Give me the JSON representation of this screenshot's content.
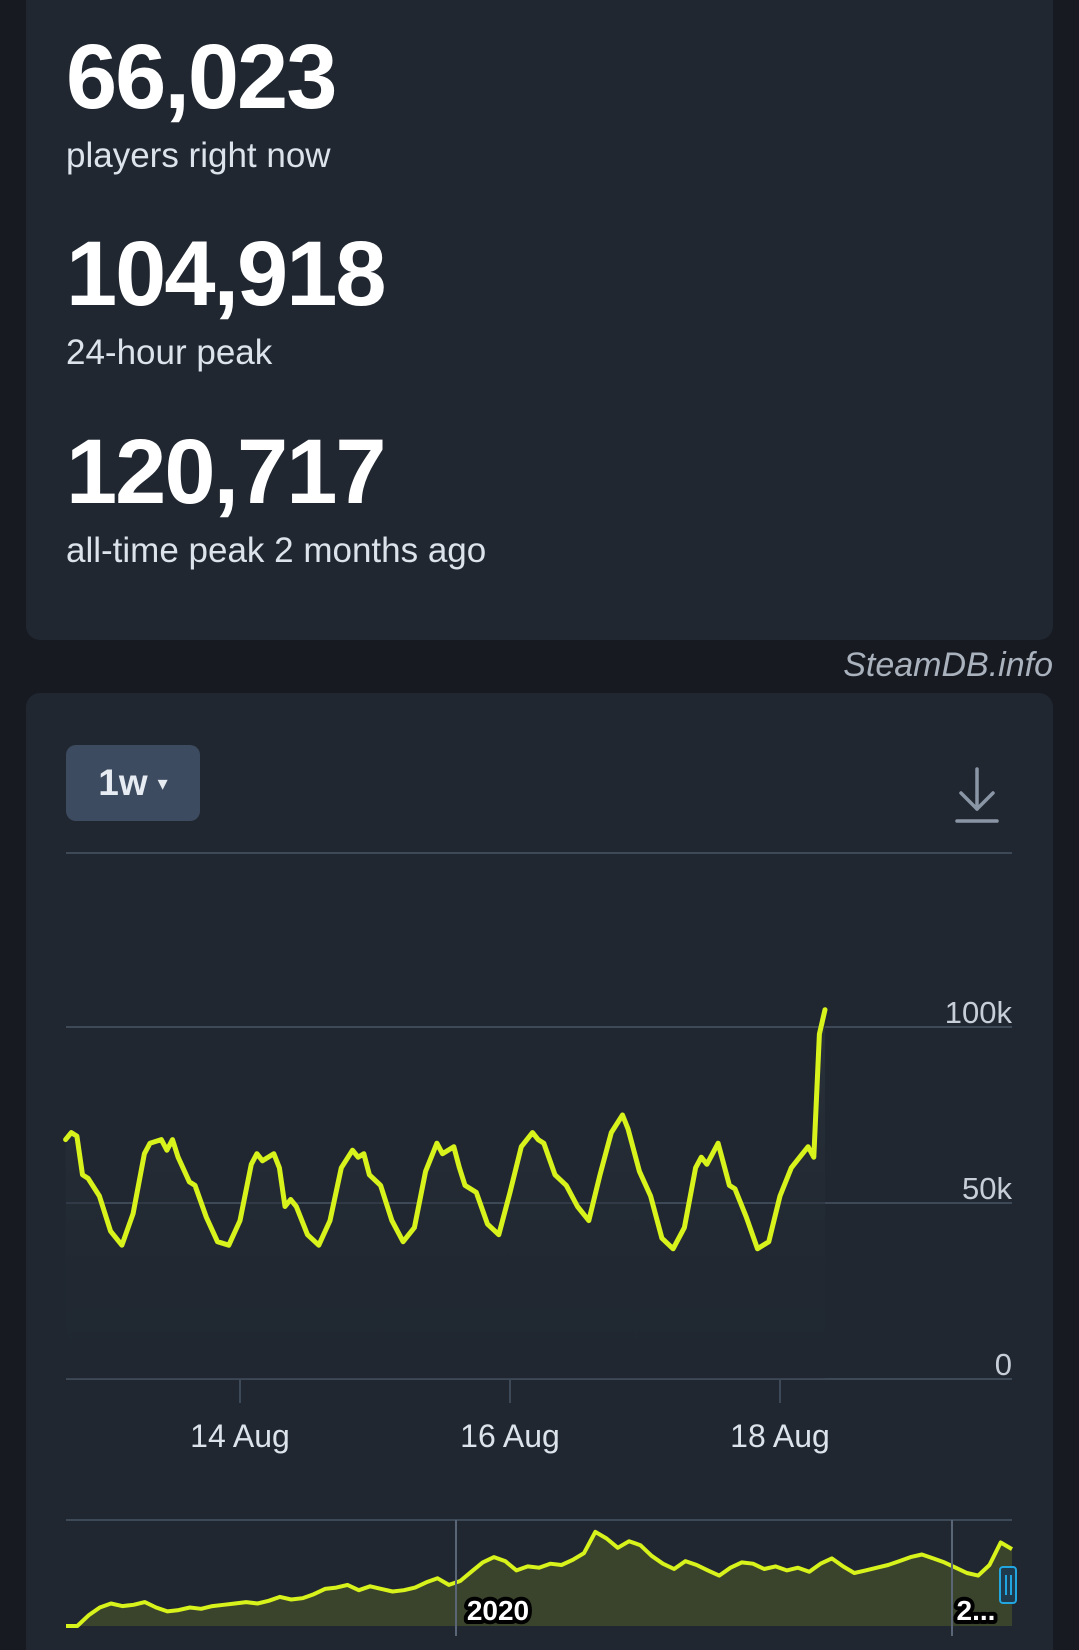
{
  "stats": {
    "current_players": {
      "value": "66,023",
      "label": "players right now"
    },
    "peak_24h": {
      "value": "104,918",
      "label": "24-hour peak"
    },
    "all_time_peak": {
      "value": "120,717",
      "label": "all-time peak 2 months ago"
    }
  },
  "watermark": "SteamDB.info",
  "controls": {
    "range_label": "1w",
    "range_caret": "▾",
    "download_icon": "download-icon"
  },
  "colors": {
    "line": "#d8f31c",
    "background": "#202731",
    "grid": "#3e4958"
  },
  "chart_data": [
    {
      "type": "line",
      "title": "",
      "xlabel": "",
      "ylabel": "",
      "ylim": [
        0,
        100000
      ],
      "yticks": [
        0,
        50000,
        100000
      ],
      "ytick_labels": [
        "0",
        "50k",
        "100k"
      ],
      "xticks": [
        "2020-08-14",
        "2020-08-16",
        "2020-08-18"
      ],
      "xtick_labels": [
        "14 Aug",
        "16 Aug",
        "18 Aug"
      ],
      "grid": true,
      "series": [
        {
          "name": "",
          "color": "#d8f31c",
          "points": [
            [
              "2020-08-12T17:00",
              68000
            ],
            [
              "2020-08-12T18:00",
              70000
            ],
            [
              "2020-08-12T19:00",
              69000
            ],
            [
              "2020-08-12T20:00",
              58000
            ],
            [
              "2020-08-12T21:00",
              57000
            ],
            [
              "2020-08-12T23:00",
              52000
            ],
            [
              "2020-08-13T01:00",
              42000
            ],
            [
              "2020-08-13T03:00",
              38000
            ],
            [
              "2020-08-13T05:00",
              47000
            ],
            [
              "2020-08-13T07:00",
              64000
            ],
            [
              "2020-08-13T08:00",
              67000
            ],
            [
              "2020-08-13T10:00",
              68000
            ],
            [
              "2020-08-13T11:00",
              65000
            ],
            [
              "2020-08-13T12:00",
              68000
            ],
            [
              "2020-08-13T13:00",
              63000
            ],
            [
              "2020-08-13T15:00",
              56000
            ],
            [
              "2020-08-13T16:00",
              55000
            ],
            [
              "2020-08-13T18:00",
              46000
            ],
            [
              "2020-08-13T20:00",
              39000
            ],
            [
              "2020-08-13T22:00",
              38000
            ],
            [
              "2020-08-14T00:00",
              45000
            ],
            [
              "2020-08-14T02:00",
              61000
            ],
            [
              "2020-08-14T03:00",
              64000
            ],
            [
              "2020-08-14T04:00",
              62000
            ],
            [
              "2020-08-14T06:00",
              64000
            ],
            [
              "2020-08-14T07:00",
              60000
            ],
            [
              "2020-08-14T08:00",
              49000
            ],
            [
              "2020-08-14T09:00",
              51000
            ],
            [
              "2020-08-14T10:00",
              49000
            ],
            [
              "2020-08-14T12:00",
              41000
            ],
            [
              "2020-08-14T14:00",
              38000
            ],
            [
              "2020-08-14T16:00",
              45000
            ],
            [
              "2020-08-14T18:00",
              60000
            ],
            [
              "2020-08-14T20:00",
              65000
            ],
            [
              "2020-08-14T21:00",
              63000
            ],
            [
              "2020-08-14T22:00",
              64000
            ],
            [
              "2020-08-14T23:00",
              58000
            ],
            [
              "2020-08-15T01:00",
              55000
            ],
            [
              "2020-08-15T03:00",
              45000
            ],
            [
              "2020-08-15T05:00",
              39000
            ],
            [
              "2020-08-15T07:00",
              43000
            ],
            [
              "2020-08-15T09:00",
              59000
            ],
            [
              "2020-08-15T11:00",
              67000
            ],
            [
              "2020-08-15T12:00",
              64000
            ],
            [
              "2020-08-15T14:00",
              66000
            ],
            [
              "2020-08-15T15:00",
              60000
            ],
            [
              "2020-08-15T16:00",
              55000
            ],
            [
              "2020-08-15T18:00",
              53000
            ],
            [
              "2020-08-15T20:00",
              44000
            ],
            [
              "2020-08-15T22:00",
              41000
            ],
            [
              "2020-08-16T00:00",
              53000
            ],
            [
              "2020-08-16T02:00",
              66000
            ],
            [
              "2020-08-16T04:00",
              70000
            ],
            [
              "2020-08-16T05:00",
              68000
            ],
            [
              "2020-08-16T06:00",
              67000
            ],
            [
              "2020-08-16T08:00",
              58000
            ],
            [
              "2020-08-16T10:00",
              55000
            ],
            [
              "2020-08-16T12:00",
              49000
            ],
            [
              "2020-08-16T14:00",
              45000
            ],
            [
              "2020-08-16T16:00",
              58000
            ],
            [
              "2020-08-16T18:00",
              70000
            ],
            [
              "2020-08-16T20:00",
              75000
            ],
            [
              "2020-08-16T21:00",
              71000
            ],
            [
              "2020-08-16T23:00",
              59000
            ],
            [
              "2020-08-17T01:00",
              52000
            ],
            [
              "2020-08-17T03:00",
              40000
            ],
            [
              "2020-08-17T05:00",
              37000
            ],
            [
              "2020-08-17T07:00",
              43000
            ],
            [
              "2020-08-17T09:00",
              60000
            ],
            [
              "2020-08-17T10:00",
              63000
            ],
            [
              "2020-08-17T11:00",
              61000
            ],
            [
              "2020-08-17T13:00",
              67000
            ],
            [
              "2020-08-17T15:00",
              55000
            ],
            [
              "2020-08-17T16:00",
              54000
            ],
            [
              "2020-08-17T18:00",
              46000
            ],
            [
              "2020-08-17T20:00",
              37000
            ],
            [
              "2020-08-17T22:00",
              39000
            ],
            [
              "2020-08-18T00:00",
              52000
            ],
            [
              "2020-08-18T02:00",
              60000
            ],
            [
              "2020-08-18T04:00",
              64000
            ],
            [
              "2020-08-18T05:00",
              66000
            ],
            [
              "2020-08-18T06:00",
              63000
            ],
            [
              "2020-08-18T07:00",
              98000
            ],
            [
              "2020-08-18T08:00",
              104918
            ]
          ]
        }
      ]
    },
    {
      "type": "area",
      "title": "",
      "x_labels": [
        "2020",
        "2..."
      ],
      "grid": false,
      "series": [
        {
          "name": "",
          "color": "#d8f31c",
          "values": [
            0,
            0,
            8,
            14,
            17,
            15,
            16,
            18,
            14,
            11,
            12,
            14,
            13,
            15,
            16,
            17,
            18,
            17,
            19,
            22,
            20,
            21,
            24,
            28,
            29,
            31,
            27,
            30,
            28,
            26,
            27,
            29,
            33,
            36,
            31,
            34,
            41,
            48,
            52,
            49,
            42,
            45,
            44,
            47,
            46,
            50,
            55,
            71,
            66,
            59,
            64,
            61,
            53,
            47,
            43,
            49,
            46,
            42,
            38,
            44,
            48,
            47,
            43,
            45,
            42,
            44,
            41,
            47,
            51,
            45,
            40,
            42,
            44,
            46,
            49,
            52,
            54,
            51,
            48,
            44,
            40,
            38,
            46,
            63,
            58
          ]
        }
      ]
    }
  ]
}
